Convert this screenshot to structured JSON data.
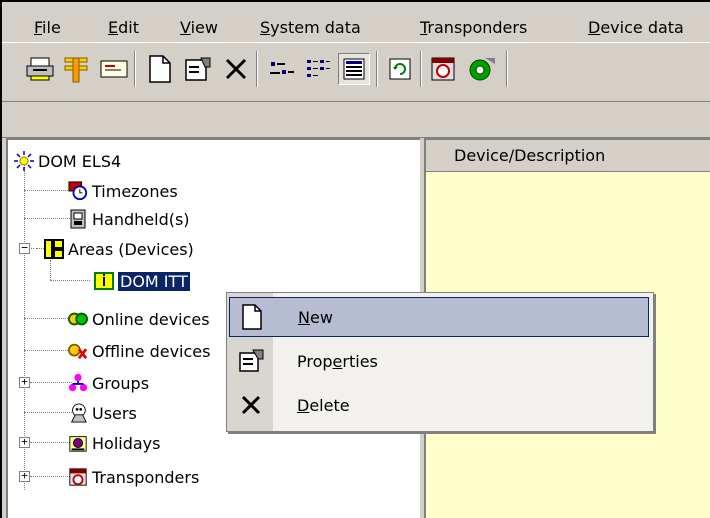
{
  "menubar": {
    "items": [
      {
        "pre": "",
        "key": "F",
        "post": "ile"
      },
      {
        "pre": "",
        "key": "E",
        "post": "dit"
      },
      {
        "pre": "",
        "key": "V",
        "post": "iew"
      },
      {
        "pre": "",
        "key": "S",
        "post": "ystem data"
      },
      {
        "pre": "",
        "key": "T",
        "post": "ransponders"
      },
      {
        "pre": "",
        "key": "D",
        "post": "evice data"
      }
    ]
  },
  "toolbar": {
    "icons": [
      "print-icon",
      "antenna-icon",
      "card-reader-icon",
      "new-document-icon",
      "properties-icon",
      "delete-icon",
      "small-icons-view-icon",
      "list-view-icon",
      "details-view-icon",
      "refresh-icon",
      "transponder-program-icon",
      "sync-icon"
    ]
  },
  "tree": {
    "root": "DOM ELS4",
    "nodes": {
      "timezones": "Timezones",
      "handhelds": "Handheld(s)",
      "areas": "Areas (Devices)",
      "dom_itt": "DOM ITT",
      "online": "Online devices",
      "offline": "Offline devices",
      "groups": "Groups",
      "users": "Users",
      "holidays": "Holidays",
      "transponders": "Transponders"
    },
    "expanders": {
      "areas": "−",
      "groups": "+",
      "holidays": "+",
      "transponders": "+"
    }
  },
  "listview": {
    "column_header": "Device/Description"
  },
  "context_menu": {
    "new": {
      "key": "N",
      "rest": "ew"
    },
    "properties": {
      "pre": "Prop",
      "key": "e",
      "rest": "rties"
    },
    "delete": {
      "key": "D",
      "rest": "elete"
    }
  },
  "colors": {
    "face": "#d4d0c8",
    "selection": "#0a246a",
    "menu_hover": "#b6bdd2",
    "list_bg": "#ffffcc"
  }
}
